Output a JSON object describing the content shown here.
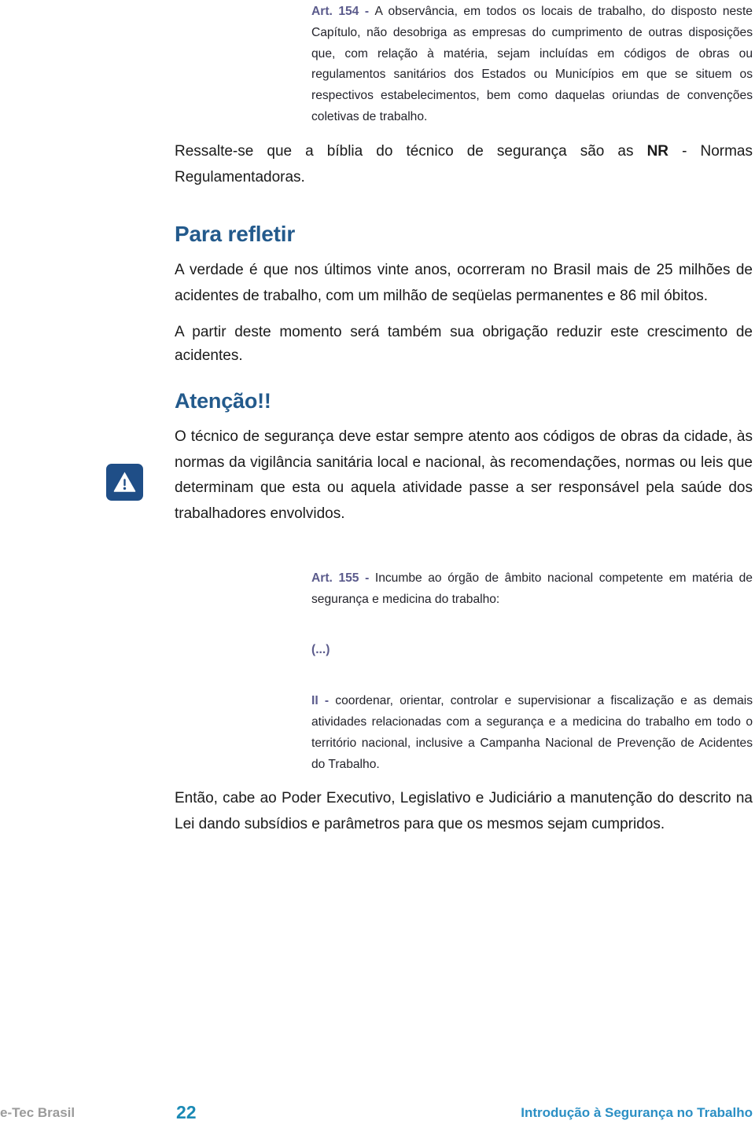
{
  "page": {
    "number": "22",
    "footer_left": "e-Tec Brasil",
    "footer_right": "Introdução à Segurança no Trabalho"
  },
  "article_154": {
    "ref": "Art. 154 - ",
    "text": "A observância, em todos os locais de trabalho, do disposto neste Capítulo, não desobriga as empresas do cumprimento de outras disposições que, com relação à matéria, sejam incluídas em códigos de obras ou regulamentos sanitários dos Estados ou Municípios em que se situem os respectivos estabelecimentos, bem como daquelas oriundas de convenções coletivas de trabalho."
  },
  "paragraph_nr": {
    "before": "Ressalte-se que a bíblia do técnico de segurança são as ",
    "bold": "NR",
    "after": " - Normas Regulamentadoras."
  },
  "para_refletir": {
    "heading": "Para refletir",
    "paragraph_1": "A verdade é que nos últimos vinte anos, ocorreram no Brasil mais de 25 milhões de acidentes de trabalho, com um milhão de seqüelas permanentes e 86 mil óbitos.",
    "paragraph_2": "A partir deste momento será também sua obrigação reduzir este crescimento de acidentes."
  },
  "atencao": {
    "icon": "warning-triangle-icon",
    "heading": "Atenção!!",
    "paragraph": "O técnico de segurança deve estar sempre atento aos códigos de obras da cidade, às normas da vigilância sanitária local e nacional, às recomendações, normas ou leis que determinam que esta ou aquela atividade passe a ser responsável pela saúde dos trabalhadores envolvidos."
  },
  "article_155": {
    "ref": "Art. 155 - ",
    "text": "Incumbe ao órgão de âmbito nacional competente em matéria de segurança e medicina do trabalho:",
    "ellipsis": "(...)",
    "item_roman": "II",
    "item_dash": " - ",
    "item_text": "coordenar, orientar, controlar e supervisionar a fiscalização e as demais atividades relacionadas com a segurança e a medicina do trabalho em todo o território nacional, inclusive a Campanha Nacional de Prevenção de Acidentes do Trabalho."
  },
  "closing_paragraph": "Então, cabe ao Poder Executivo, Legislativo e Judiciário a manutenção do descrito na Lei dando subsídios e parâmetros para que os mesmos sejam cumpridos.",
  "colors": {
    "heading_blue": "#235a8c",
    "article_purple": "#5b5b8c",
    "icon_blue": "#1f4e87",
    "footer_page_blue": "#1b8ab5",
    "footer_right_blue": "#2b8fc4",
    "footer_left_gray": "#9b9b9b"
  }
}
